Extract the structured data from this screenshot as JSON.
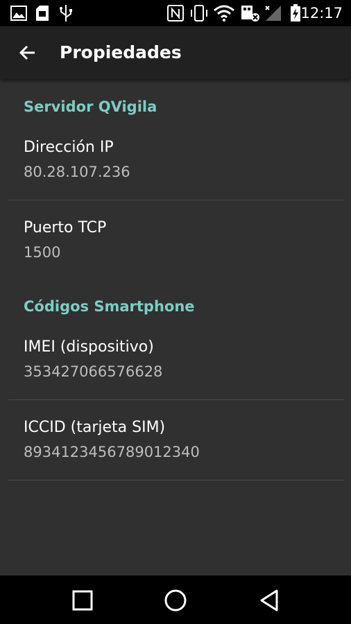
{
  "status_bar": {
    "time": "12:17",
    "icons": [
      "image-icon",
      "sd-card-icon",
      "usb-icon",
      "nfc-icon",
      "vibrate-icon",
      "wifi-icon",
      "data-off-icon",
      "signal-icon",
      "battery-charging-icon"
    ]
  },
  "toolbar": {
    "title": "Propiedades",
    "back_icon": "arrow-back-icon"
  },
  "sections": [
    {
      "header": "Servidor QVigila",
      "items": [
        {
          "title": "Dirección IP",
          "summary": "80.28.107.236"
        },
        {
          "title": "Puerto TCP",
          "summary": "1500"
        }
      ]
    },
    {
      "header": "Códigos Smartphone",
      "items": [
        {
          "title": "IMEI (dispositivo)",
          "summary": "353427066576628"
        },
        {
          "title": "ICCID (tarjeta SIM)",
          "summary": "8934123456789012340"
        }
      ]
    }
  ],
  "nav_bar": {
    "icons": [
      "recents-square-icon",
      "home-circle-icon",
      "back-triangle-icon"
    ]
  },
  "colors": {
    "accent": "#80cbc4",
    "background": "#303030",
    "toolbar": "#212121"
  }
}
